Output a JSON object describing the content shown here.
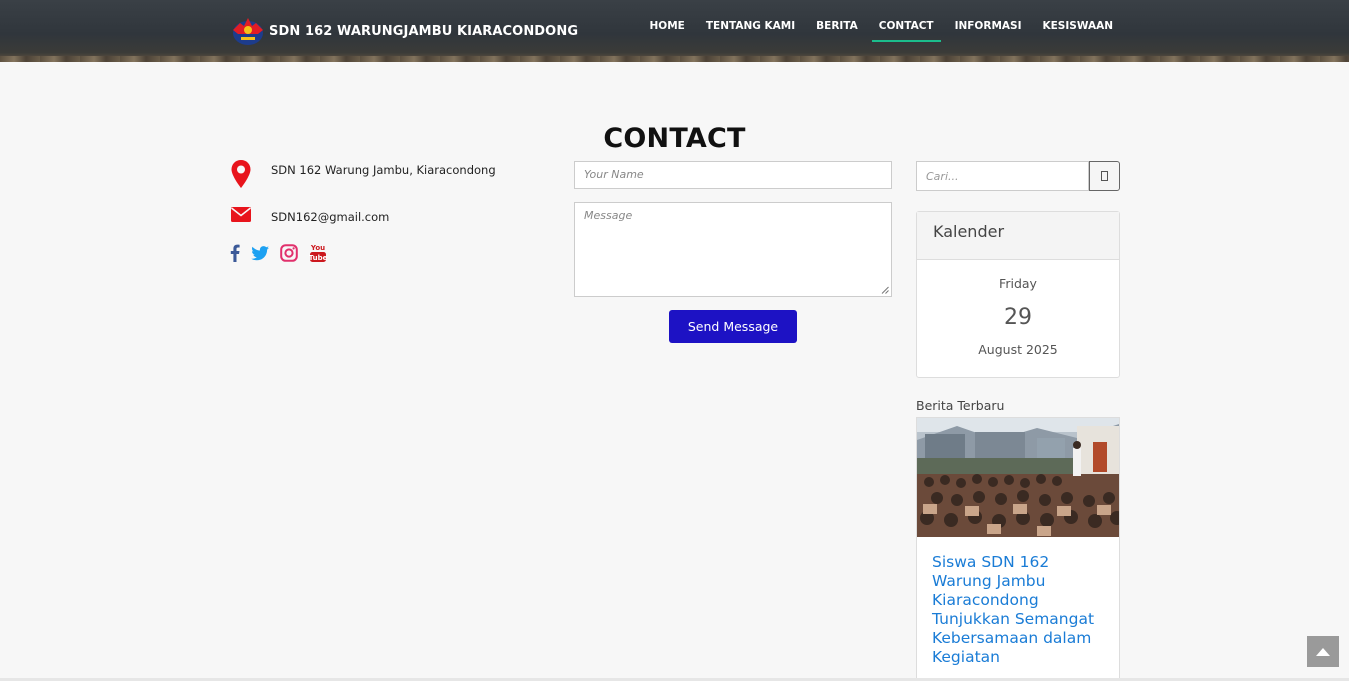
{
  "header": {
    "brand_title": "SDN 162 WARUNGJAMBU KIARACONDONG",
    "nav": [
      {
        "label": "HOME",
        "active": false
      },
      {
        "label": "TENTANG KAMI",
        "active": false
      },
      {
        "label": "BERITA",
        "active": false
      },
      {
        "label": "CONTACT",
        "active": true
      },
      {
        "label": "INFORMASI",
        "active": false
      },
      {
        "label": "KESISWAAN",
        "active": false
      }
    ]
  },
  "page": {
    "heading": "CONTACT"
  },
  "contact": {
    "address": "SDN 162 Warung Jambu, Kiaracondong",
    "email": "SDN162@gmail.com",
    "icons": {
      "address": "map-pin-icon",
      "email": "envelope-icon"
    },
    "socials": [
      "facebook-icon",
      "twitter-icon",
      "instagram-icon",
      "youtube-icon"
    ]
  },
  "form": {
    "name_placeholder": "Your Name",
    "message_placeholder": "Message",
    "send_label": "Send Message"
  },
  "sidebar": {
    "search_placeholder": "Cari...",
    "calendar": {
      "title": "Kalender",
      "day_name": "Friday",
      "day": "29",
      "month_year": "August 2025"
    },
    "recent": {
      "title": "Berita Terbaru",
      "article_title": "Siswa SDN 162 Warung Jambu Kiaracondong Tunjukkan Semangat Kebersamaan dalam Kegiatan"
    }
  },
  "colors": {
    "accent_active": "#1bbd8c",
    "send_button": "#1d12c4",
    "link": "#1a7cd6",
    "icon_red": "#e8141c"
  }
}
